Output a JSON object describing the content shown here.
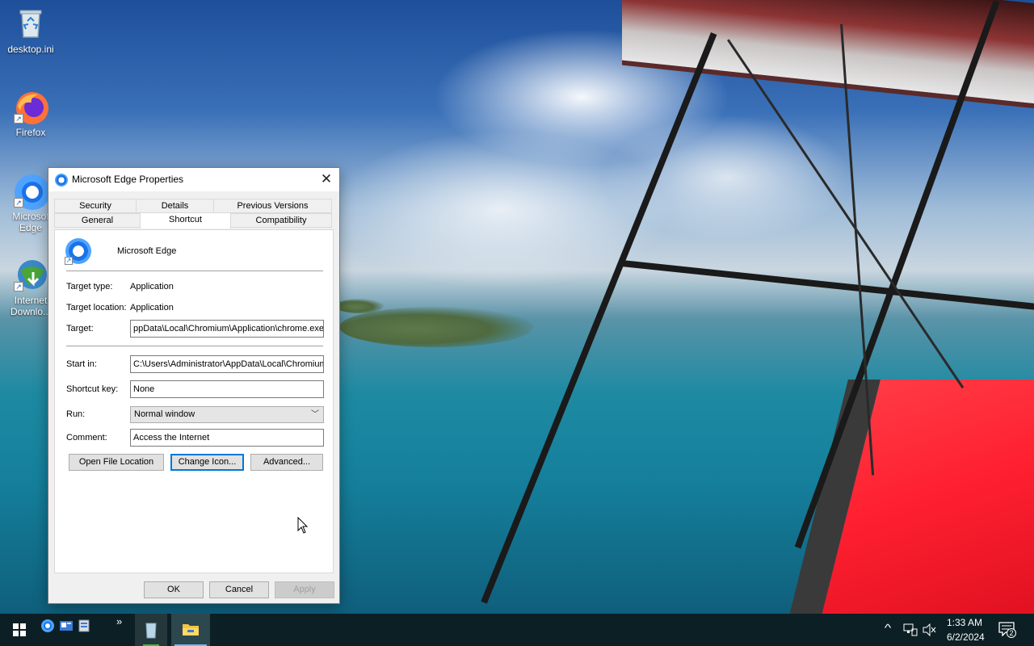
{
  "desktop": {
    "icons": [
      {
        "label": "desktop.ini",
        "icon": "recycle-bin-icon"
      },
      {
        "label": "Firefox",
        "icon": "firefox-icon"
      },
      {
        "label_line1": "Microsof",
        "label_line2": "Edge",
        "icon": "chromium-icon"
      },
      {
        "label_line1": "Internet",
        "label_line2": "Downlo...",
        "icon": "internet-download-manager-icon"
      }
    ]
  },
  "dialog": {
    "title": "Microsoft Edge Properties",
    "close_glyph": "✕",
    "tabs": {
      "security": "Security",
      "details": "Details",
      "previous_versions": "Previous Versions",
      "general": "General",
      "shortcut": "Shortcut",
      "compatibility": "Compatibility"
    },
    "active_tab": "Shortcut",
    "app_name": "Microsoft Edge",
    "labels": {
      "target_type": "Target type:",
      "target_location": "Target location:",
      "target": "Target:",
      "start_in": "Start in:",
      "shortcut_key": "Shortcut key:",
      "run": "Run:",
      "comment": "Comment:"
    },
    "values": {
      "target_type": "Application",
      "target_location": "Application",
      "target": "ppData\\Local\\Chromium\\Application\\chrome.exe",
      "start_in": "C:\\Users\\Administrator\\AppData\\Local\\Chromium",
      "shortcut_key": "None",
      "run": "Normal window",
      "comment": "Access the Internet"
    },
    "buttons": {
      "open_file_location": "Open File Location",
      "change_icon": "Change Icon...",
      "advanced": "Advanced...",
      "ok": "OK",
      "cancel": "Cancel",
      "apply": "Apply"
    }
  },
  "taskbar": {
    "chevron": "»",
    "clock_time": "1:33 AM",
    "clock_date": "6/2/2024",
    "notification_count": "2",
    "tray_up_glyph": "^"
  }
}
